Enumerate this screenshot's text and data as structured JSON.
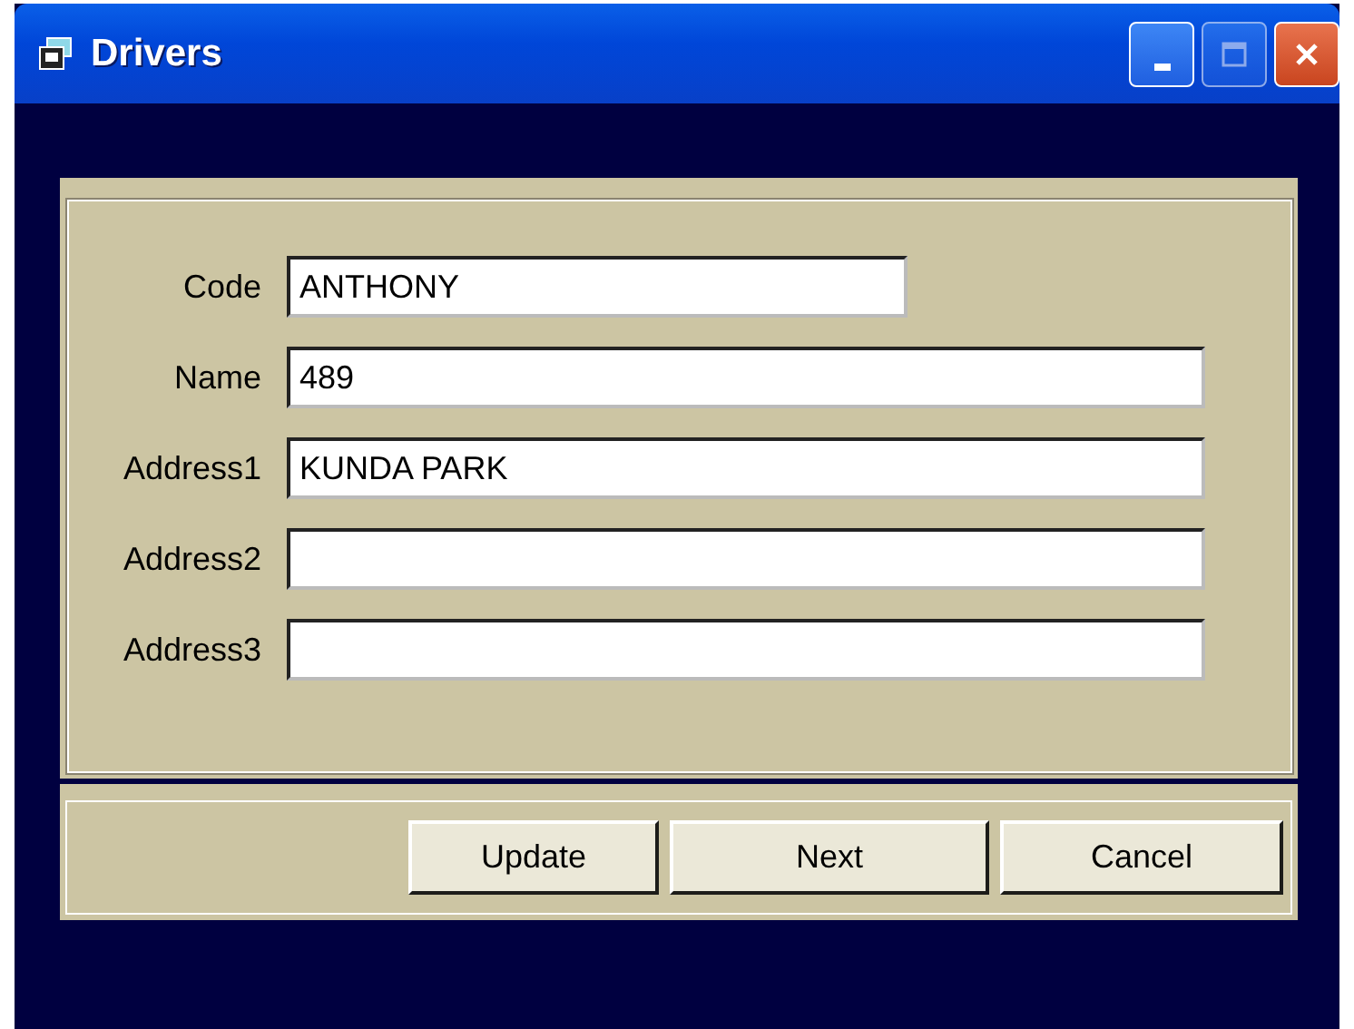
{
  "window": {
    "title": "Drivers",
    "controls": [
      {
        "kind": "minimize",
        "disabled": false
      },
      {
        "kind": "maximize",
        "disabled": true
      },
      {
        "kind": "close",
        "disabled": false
      }
    ]
  },
  "fields": [
    {
      "label": "Code",
      "value": "ANTHONY",
      "kind": "short"
    },
    {
      "label": "Name",
      "value": "489",
      "kind": "full"
    },
    {
      "label": "Address1",
      "value": "KUNDA PARK",
      "kind": "full"
    },
    {
      "label": "Address2",
      "kind": "full"
    },
    {
      "label": "Address3",
      "kind": "full"
    }
  ],
  "buttons": [
    "Update",
    "Next",
    "Cancel"
  ]
}
